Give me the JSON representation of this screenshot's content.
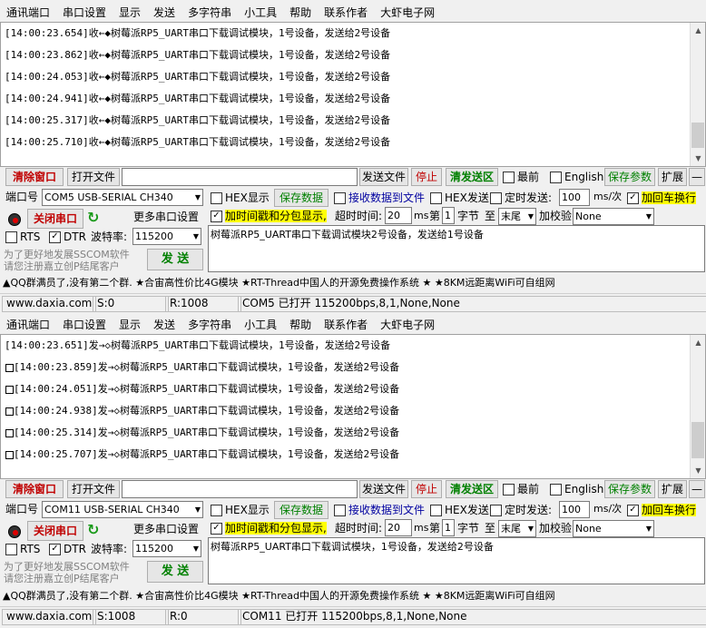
{
  "menu": [
    "通讯端口",
    "串口设置",
    "显示",
    "发送",
    "多字符串",
    "小工具",
    "帮助",
    "联系作者",
    "大虾电子网"
  ],
  "instances": [
    {
      "log_lines": [
        "[14:00:23.654]收←◆树莓派RP5_UART串口下载调试模块，1号设备，发送给2号设备",
        "[14:00:23.862]收←◆树莓派RP5_UART串口下载调试模块，1号设备，发送给2号设备",
        "[14:00:24.053]收←◆树莓派RP5_UART串口下载调试模块，1号设备，发送给2号设备",
        "[14:00:24.941]收←◆树莓派RP5_UART串口下载调试模块，1号设备，发送给2号设备",
        "[14:00:25.317]收←◆树莓派RP5_UART串口下载调试模块，1号设备，发送给2号设备",
        "[14:00:25.710]收←◆树莓派RP5_UART串口下载调试模块，1号设备，发送给2号设备"
      ],
      "port_value": "COM5 USB-SERIAL CH340",
      "baud_value": "115200",
      "send_text": "树莓派RP5_UART串口下载调试模块2号设备，发送给1号设备",
      "status": {
        "site": "www.daxia.com",
        "sent": "S:0",
        "received": "R:1008",
        "port_status": "COM5 已打开  115200bps,8,1,None,None"
      }
    },
    {
      "log_lines": [
        "[14:00:23.651]发→◇树莓派RP5_UART串口下载调试模块，1号设备，发送给2号设备",
        "[14:00:23.859]发→◇树莓派RP5_UART串口下载调试模块，1号设备，发送给2号设备",
        "[14:00:24.051]发→◇树莓派RP5_UART串口下载调试模块，1号设备，发送给2号设备",
        "[14:00:24.938]发→◇树莓派RP5_UART串口下载调试模块，1号设备，发送给2号设备",
        "[14:00:25.314]发→◇树莓派RP5_UART串口下载调试模块，1号设备，发送给2号设备",
        "[14:00:25.707]发→◇树莓派RP5_UART串口下载调试模块，1号设备，发送给2号设备"
      ],
      "port_value": "COM11 USB-SERIAL CH340",
      "baud_value": "115200",
      "send_text": "树莓派RP5_UART串口下载调试模块，1号设备，发送给2号设备",
      "status": {
        "site": "www.daxia.com",
        "sent": "S:1008",
        "received": "R:0",
        "port_status": "COM11 已打开  115200bps,8,1,None,None"
      }
    }
  ],
  "toolbar": {
    "clear_window": "清除窗口",
    "open_file": "打开文件",
    "send_file": "发送文件",
    "stop": "停止",
    "clear_send_area": "清发送区",
    "front_label": "最前",
    "english_label": "English",
    "save_params": "保存参数",
    "expand": "扩展",
    "collapse": "—"
  },
  "controls": {
    "port_label": "端口号",
    "close_port": "关闭串口",
    "more_settings": "更多串口设置",
    "rts": "RTS",
    "dtr": "DTR",
    "baud_label": "波特率:",
    "promo_line1": "为了更好地发展SSCOM软件",
    "promo_line2": "请您注册嘉立创P结尾客户",
    "send_button": "发 送",
    "hex_display": "HEX显示",
    "save_data": "保存数据",
    "receive_to_file": "接收数据到文件",
    "hex_send": "HEX发送",
    "timed_send": "定时发送:",
    "timed_interval": "100",
    "interval_unit": "ms/次",
    "add_crlf": "加回车换行",
    "timestamp_split": "加时间戳和分包显示,",
    "timeout_label": "超时时间:",
    "timeout_value": "20",
    "timeout_unit": "ms",
    "nth_label": "第",
    "nth_value": "1",
    "byte_label": "字节",
    "to_label": "至",
    "end_value": "末尾",
    "checksum_label": "加校验",
    "checksum_value": "None"
  },
  "ticker": "▲QQ群满员了,没有第二个群. ★合宙高性价比4G模块 ★RT-Thread中国人的开源免费操作系统 ★ ★8KM远距离WiFi可自组网"
}
